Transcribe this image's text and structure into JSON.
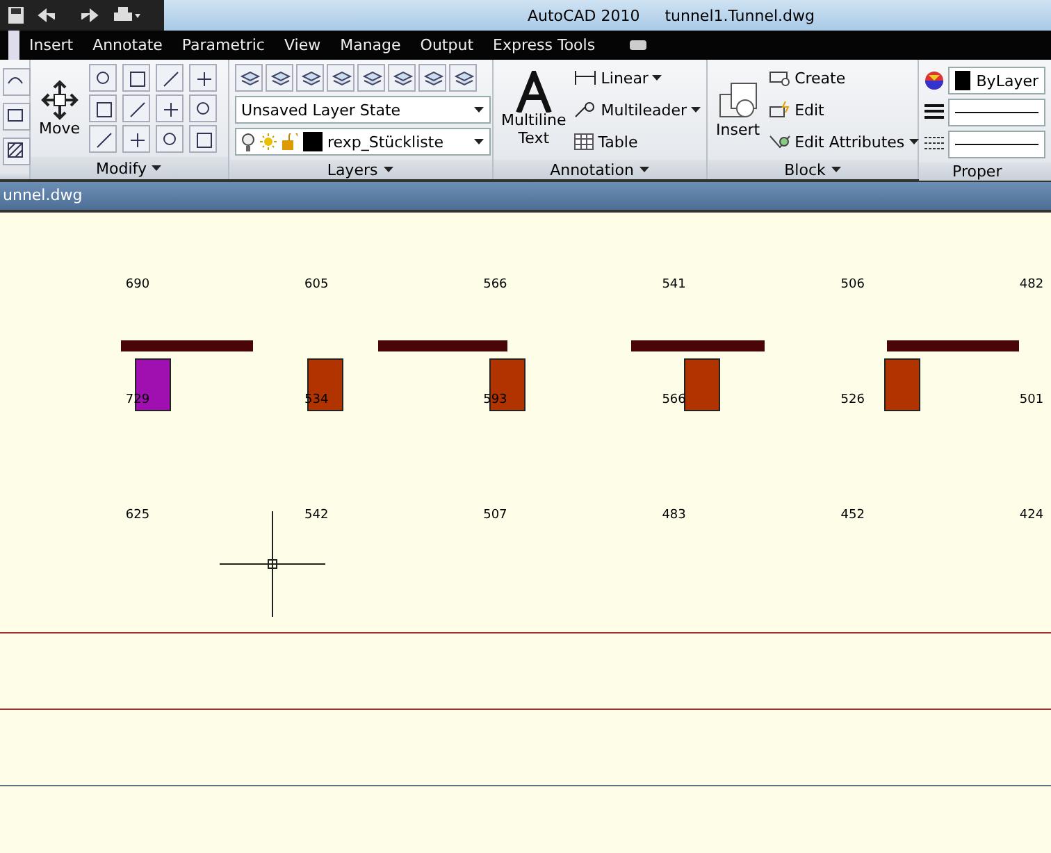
{
  "title_bar": {
    "app": "AutoCAD 2010",
    "document": "tunnel1.Tunnel.dwg"
  },
  "ribbon_tabs": [
    {
      "label": "Insert",
      "selected": false
    },
    {
      "label": "Annotate",
      "selected": false
    },
    {
      "label": "Parametric",
      "selected": false
    },
    {
      "label": "View",
      "selected": false
    },
    {
      "label": "Manage",
      "selected": false
    },
    {
      "label": "Output",
      "selected": false
    },
    {
      "label": "Express Tools",
      "selected": false
    }
  ],
  "panels": {
    "modify": {
      "title": "Modify",
      "move": "Move"
    },
    "layers": {
      "title": "Layers",
      "layer_state": "Unsaved Layer State",
      "current_layer": "rexp_Stückliste"
    },
    "annotation": {
      "title": "Annotation",
      "text_lines": [
        "Multiline",
        "Text"
      ],
      "linear": "Linear",
      "multileader": "Multileader",
      "table": "Table"
    },
    "block": {
      "title": "Block",
      "insert": "Insert",
      "create": "Create",
      "edit": "Edit",
      "edit_attributes": "Edit Attributes"
    },
    "properties": {
      "title": "Proper",
      "color_setting": "ByLayer"
    }
  },
  "document_tab": "unnel.dwg",
  "drawing": {
    "label_rows": [
      [
        "690",
        "605",
        "566",
        "541",
        "506",
        "482"
      ],
      [
        "729",
        "534",
        "593",
        "566",
        "526",
        "501"
      ],
      [
        "625",
        "542",
        "507",
        "483",
        "452",
        "424"
      ]
    ],
    "blocks": [
      {
        "color": "#a010b0"
      },
      {
        "color": "#b03300"
      },
      {
        "color": "#b03300"
      },
      {
        "color": "#b03300"
      },
      {
        "color": "#b03300"
      }
    ]
  }
}
